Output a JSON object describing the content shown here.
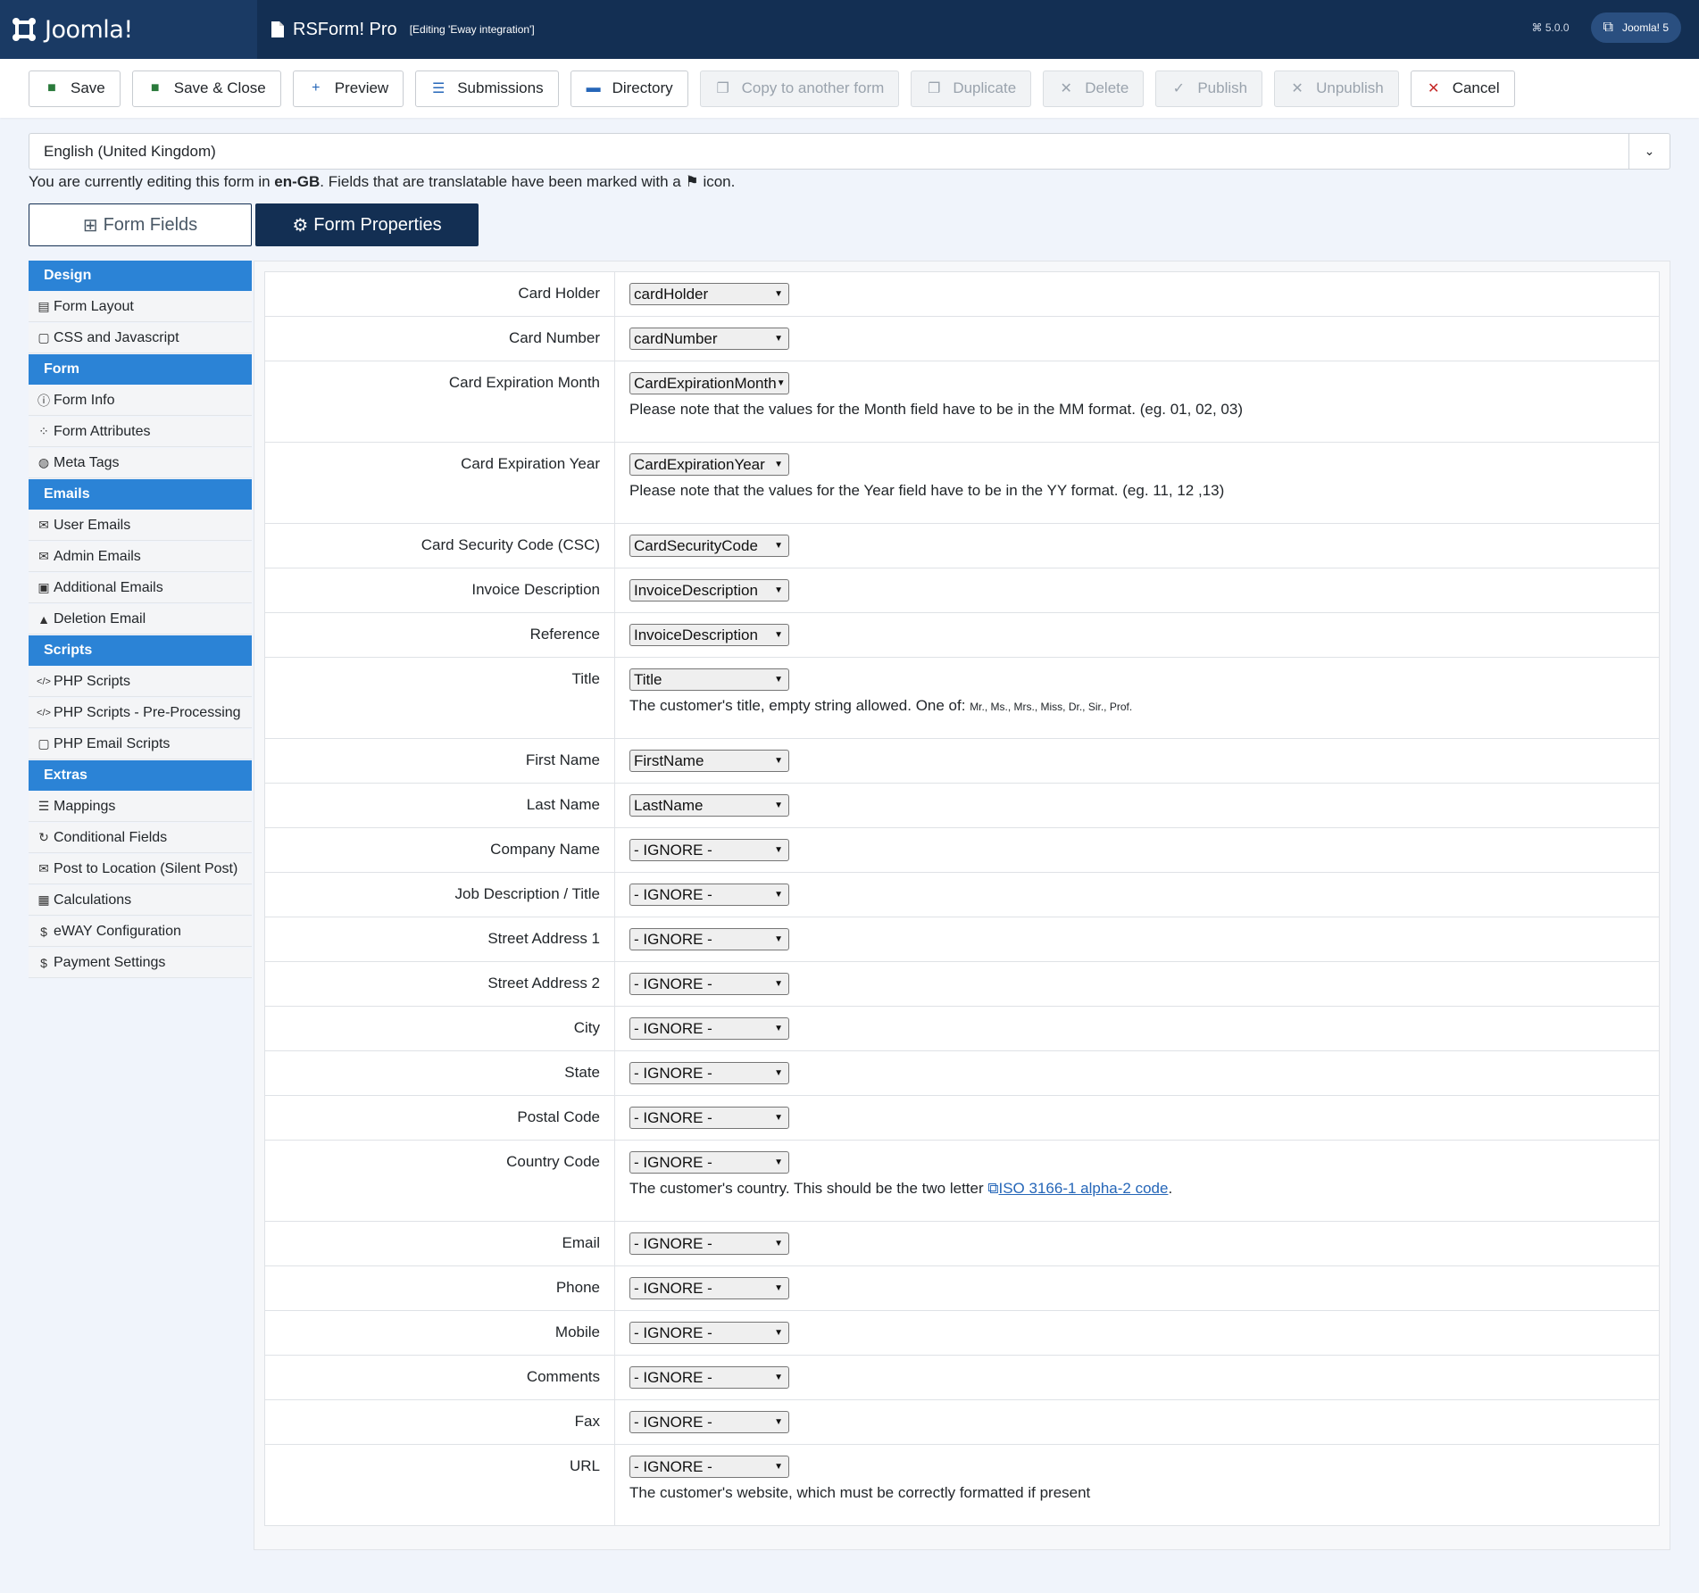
{
  "header": {
    "logo_text": "Joomla!",
    "title": "RSForm! Pro",
    "subtitle": "[Editing 'Eway integration']",
    "version": "5.0.0",
    "site_link": "Joomla! 5"
  },
  "toolbar": {
    "buttons": [
      {
        "label": "Save",
        "icon": "save-icon",
        "disabled": false
      },
      {
        "label": "Save & Close",
        "icon": "save-icon",
        "disabled": false
      },
      {
        "label": "Preview",
        "icon": "plus-icon",
        "disabled": false
      },
      {
        "label": "Submissions",
        "icon": "database-icon",
        "disabled": false
      },
      {
        "label": "Directory",
        "icon": "folder-icon",
        "disabled": false
      },
      {
        "label": "Copy to another form",
        "icon": "copy-icon",
        "disabled": true
      },
      {
        "label": "Duplicate",
        "icon": "copy-icon",
        "disabled": true
      },
      {
        "label": "Delete",
        "icon": "times-icon",
        "disabled": true
      },
      {
        "label": "Publish",
        "icon": "check-icon",
        "disabled": true
      },
      {
        "label": "Unpublish",
        "icon": "times-icon",
        "disabled": true
      },
      {
        "label": "Cancel",
        "icon": "times-icon",
        "disabled": false
      }
    ]
  },
  "language": {
    "selected": "English (United Kingdom)",
    "note_prefix": "You are currently editing this form in ",
    "note_code": "en-GB",
    "note_suffix": ". Fields that are translatable have been marked with a ",
    "note_end": " icon."
  },
  "tabs": [
    {
      "label": "Form Fields",
      "active": false
    },
    {
      "label": "Form Properties",
      "active": true
    }
  ],
  "sidebar": [
    {
      "type": "head",
      "label": "Design"
    },
    {
      "type": "item",
      "label": "Form Layout",
      "icon": "layout-icon"
    },
    {
      "type": "item",
      "label": "CSS and Javascript",
      "icon": "file-code-icon"
    },
    {
      "type": "head",
      "label": "Form"
    },
    {
      "type": "item",
      "label": "Form Info",
      "icon": "info-icon"
    },
    {
      "type": "item",
      "label": "Form Attributes",
      "icon": "attributes-icon"
    },
    {
      "type": "item",
      "label": "Meta Tags",
      "icon": "globe-icon"
    },
    {
      "type": "head",
      "label": "Emails"
    },
    {
      "type": "item",
      "label": "User Emails",
      "icon": "envelope-open-icon"
    },
    {
      "type": "item",
      "label": "Admin Emails",
      "icon": "envelope-icon"
    },
    {
      "type": "item",
      "label": "Additional Emails",
      "icon": "envelope-square-icon"
    },
    {
      "type": "item",
      "label": "Deletion Email",
      "icon": "bell-icon"
    },
    {
      "type": "head",
      "label": "Scripts"
    },
    {
      "type": "item",
      "label": "PHP Scripts",
      "icon": "code-icon"
    },
    {
      "type": "item",
      "label": "PHP Scripts - Pre-Processing",
      "icon": "code-icon"
    },
    {
      "type": "item",
      "label": "PHP Email Scripts",
      "icon": "file-code-icon"
    },
    {
      "type": "head",
      "label": "Extras"
    },
    {
      "type": "item",
      "label": "Mappings",
      "icon": "database-icon"
    },
    {
      "type": "item",
      "label": "Conditional Fields",
      "icon": "refresh-icon"
    },
    {
      "type": "item",
      "label": "Post to Location (Silent Post)",
      "icon": "envelope-icon"
    },
    {
      "type": "item",
      "label": "Calculations",
      "icon": "calculator-icon"
    },
    {
      "type": "item",
      "label": "eWAY Configuration",
      "icon": "dollar-circle-icon"
    },
    {
      "type": "item",
      "label": "Payment Settings",
      "icon": "dollar-icon"
    }
  ],
  "fields": [
    {
      "label": "Card Holder",
      "value": "cardHolder"
    },
    {
      "label": "Card Number",
      "value": "cardNumber"
    },
    {
      "label": "Card Expiration Month",
      "value": "CardExpirationMonth",
      "help": "Please note that the values for the Month field have to be in the MM format. (eg. 01, 02, 03)"
    },
    {
      "label": "Card Expiration Year",
      "value": "CardExpirationYear",
      "help": "Please note that the values for the Year field have to be in the YY format. (eg. 11, 12 ,13)"
    },
    {
      "label": "Card Security Code (CSC)",
      "value": "CardSecurityCode"
    },
    {
      "label": "Invoice Description",
      "value": "InvoiceDescription"
    },
    {
      "label": "Reference",
      "value": "InvoiceDescription"
    },
    {
      "label": "Title",
      "value": "Title",
      "help": "The customer's title, empty string allowed. One of: ",
      "help_small": "Mr., Ms., Mrs., Miss, Dr., Sir., Prof."
    },
    {
      "label": "First Name",
      "value": "FirstName"
    },
    {
      "label": "Last Name",
      "value": "LastName"
    },
    {
      "label": "Company Name",
      "value": "- IGNORE -"
    },
    {
      "label": "Job Description / Title",
      "value": "- IGNORE -"
    },
    {
      "label": "Street Address 1",
      "value": "- IGNORE -"
    },
    {
      "label": "Street Address 2",
      "value": "- IGNORE -"
    },
    {
      "label": "City",
      "value": "- IGNORE -"
    },
    {
      "label": "State",
      "value": "- IGNORE -"
    },
    {
      "label": "Postal Code",
      "value": "- IGNORE -"
    },
    {
      "label": "Country Code",
      "value": "- IGNORE -",
      "help": "The customer's country. This should be the two letter ",
      "help_link": "ISO 3166-1 alpha-2 code",
      "help_after": "."
    },
    {
      "label": "Email",
      "value": "- IGNORE -"
    },
    {
      "label": "Phone",
      "value": "- IGNORE -"
    },
    {
      "label": "Mobile",
      "value": "- IGNORE -"
    },
    {
      "label": "Comments",
      "value": "- IGNORE -"
    },
    {
      "label": "Fax",
      "value": "- IGNORE -"
    },
    {
      "label": "URL",
      "value": "- IGNORE -",
      "help": "The customer's website, which must be correctly formatted if present"
    }
  ]
}
